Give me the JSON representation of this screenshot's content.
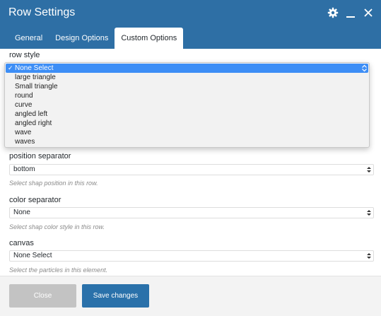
{
  "dialog": {
    "title": "Row Settings"
  },
  "header_icons": [
    "gear-icon",
    "minimize-icon",
    "close-icon"
  ],
  "tabs": [
    {
      "label": "General",
      "active": false
    },
    {
      "label": "Design Options",
      "active": false
    },
    {
      "label": "Custom Options",
      "active": true
    }
  ],
  "fields": {
    "row_style": {
      "label": "row style",
      "options": [
        "None Select",
        "large triangle",
        "Small triangle",
        "round",
        "curve",
        "angled left",
        "angled right",
        "wave",
        "waves"
      ],
      "selected": "None Select",
      "checkmark": "✓"
    },
    "position_separator": {
      "label": "position separator",
      "value": "bottom",
      "description": "Select shap position in this row."
    },
    "color_separator": {
      "label": "color separator",
      "value": "None",
      "description": "Select shap color style in this row."
    },
    "canvas": {
      "label": "canvas",
      "value": "None Select",
      "description": "Select the particles in this element."
    }
  },
  "footer": {
    "close_label": "Close",
    "save_label": "Save changes"
  },
  "colors": {
    "header": "#2e6fa5",
    "save_button": "#2a71aa",
    "close_button": "#c3c3c3",
    "selected_option": "#3d8ef6"
  }
}
